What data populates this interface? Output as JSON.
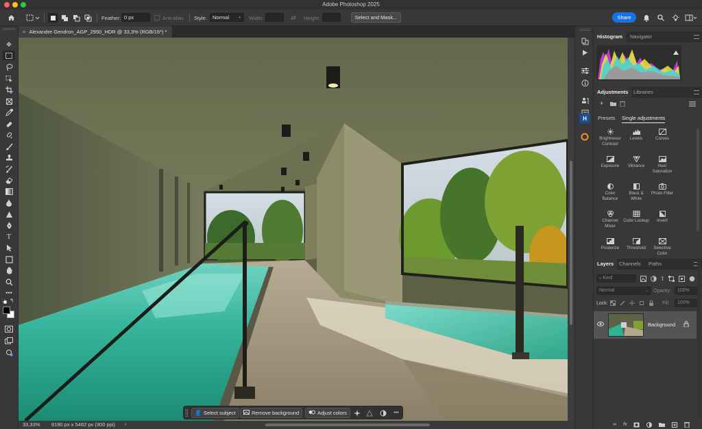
{
  "app": {
    "title": "Adobe Photoshop 2025"
  },
  "options": {
    "feather_label": "Feather:",
    "feather_value": "0 px",
    "antialias_label": "Anti-alias",
    "style_label": "Style:",
    "style_value": "Normal",
    "width_label": "Width:",
    "height_label": "Height:",
    "select_mask_label": "Select and Mask...",
    "share_label": "Share"
  },
  "document": {
    "tab_label": "Alexandre Gendron_AGP_2950_HDR @ 33,3% (RGB/16*) *"
  },
  "status": {
    "zoom": "33,33%",
    "dimensions": "8190 px x 5462 px (300 ppi)"
  },
  "taskbar": {
    "select_subject": "Select subject",
    "remove_background": "Remove background",
    "adjust_colors": "Adjust colors",
    "more": "•••"
  },
  "panels": {
    "histogram_tabs": [
      "Histogram",
      "Navigator"
    ],
    "adjustments_tabs": [
      "Adjustments",
      "Libraries"
    ],
    "adjustment_subtabs": [
      "Presets",
      "Single adjustments"
    ],
    "adjustments": [
      "Brightness/ Contrast",
      "Levels",
      "Curves",
      "Exposure",
      "Vibrance",
      "Hue/ Saturation",
      "Color Balance",
      "Black & White",
      "Photo Filter",
      "Channel Mixer",
      "Color Lookup",
      "Invert",
      "Posterize",
      "Threshold",
      "Selective Color"
    ],
    "layers_tabs": [
      "Layers",
      "Channels",
      "Paths"
    ],
    "layers_kind_placeholder": "Kind",
    "blend_mode": "Normal",
    "opacity_label": "Opacity:",
    "opacity_value": "100%",
    "lock_label": "Lock:",
    "fill_label": "Fill:",
    "fill_value": "100%",
    "layer_name": "Background"
  },
  "colors": {
    "accent": "#1473e6",
    "panel_bg": "#383838",
    "canvas_wall": "#5d6045",
    "pool_water": "#3fb79a"
  }
}
